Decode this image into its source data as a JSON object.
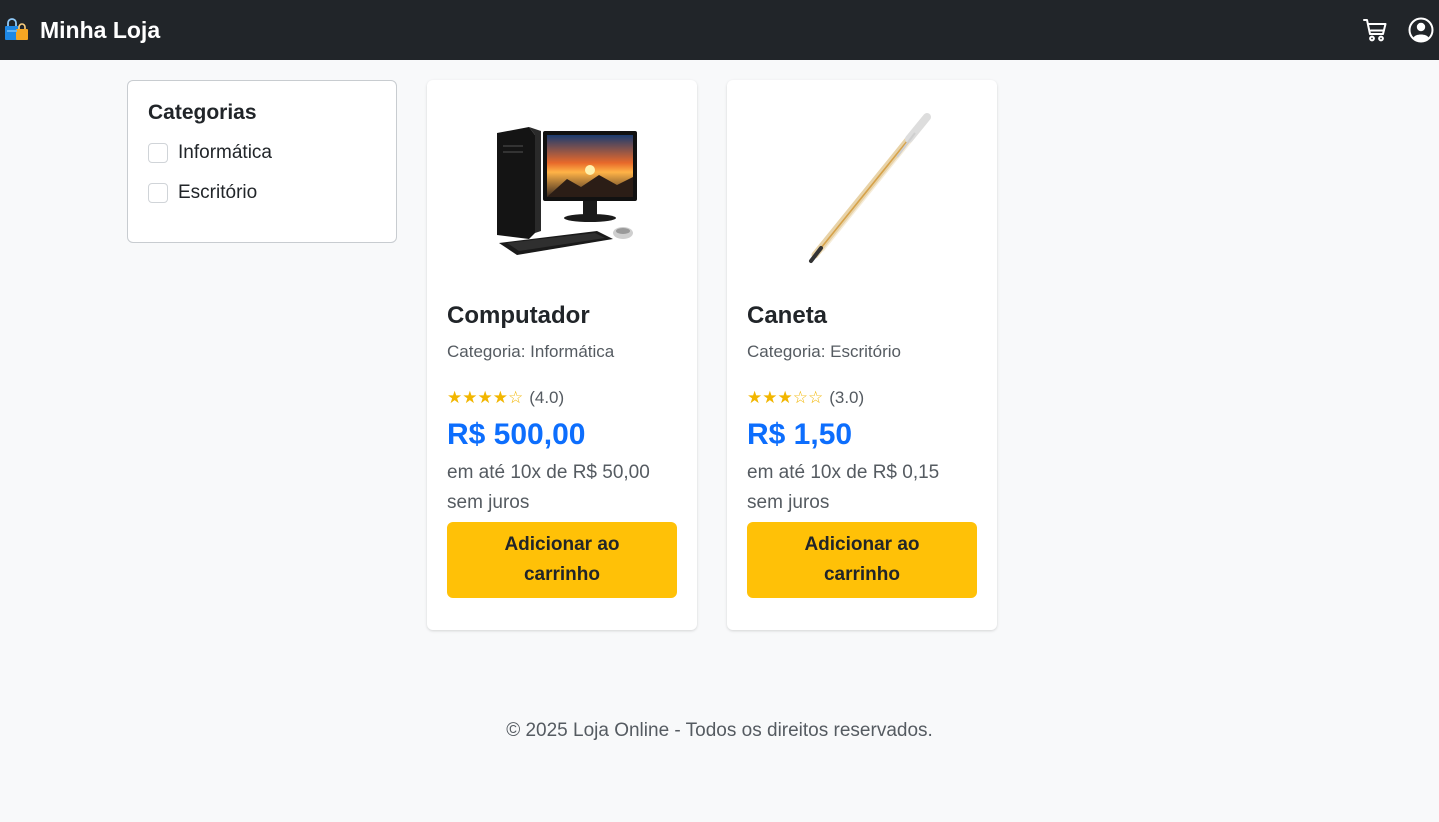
{
  "header": {
    "brand": "Minha Loja",
    "icons": [
      "shopping-bags-icon",
      "cart-icon",
      "user-circle-icon"
    ]
  },
  "sidebar": {
    "title": "Categorias",
    "items": [
      {
        "label": "Informática",
        "checked": false
      },
      {
        "label": "Escritório",
        "checked": false
      }
    ]
  },
  "products": [
    {
      "name": "Computador",
      "category": "Categoria: Informática",
      "stars": "★★★★☆",
      "rating": "(4.0)",
      "price": "R$ 500,00",
      "installment_line1": "em até 10x de R$ 50,00",
      "installment_line2": "sem juros",
      "button_line1": "Adicionar ao",
      "button_line2": "carrinho",
      "image": "desktop-computer-image"
    },
    {
      "name": "Caneta",
      "category": "Categoria: Escritório",
      "stars": "★★★☆☆",
      "rating": "(3.0)",
      "price": "R$ 1,50",
      "installment_line1": "em até 10x de R$ 0,15",
      "installment_line2": "sem juros",
      "button_line1": "Adicionar ao",
      "button_line2": "carrinho",
      "image": "pen-image"
    }
  ],
  "footer": {
    "text": "© 2025 Loja Online - Todos os direitos reservados."
  },
  "colors": {
    "navbar": "#212529",
    "accent_price": "#0d6efd",
    "button": "#ffc107",
    "star": "#f2b600",
    "background": "#f8f9fa"
  }
}
